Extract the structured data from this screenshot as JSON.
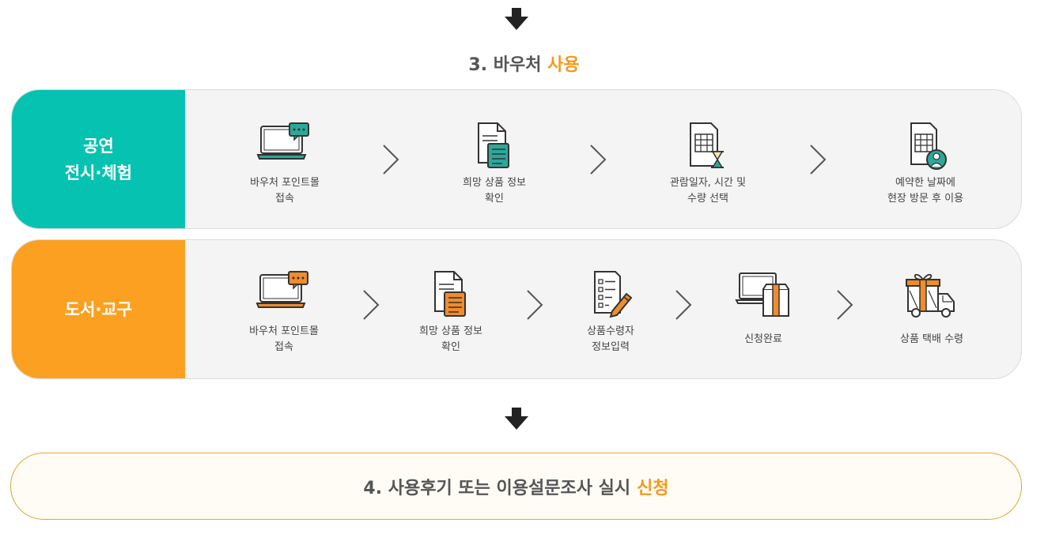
{
  "section3": {
    "title_main": "3. 바우처",
    "title_accent": "사용"
  },
  "performance": {
    "label_line1": "공연",
    "label_line2": "전시·체험",
    "steps": [
      {
        "line1": "바우처 포인트몰",
        "line2": "접속"
      },
      {
        "line1": "희망 상품 정보",
        "line2": "확인"
      },
      {
        "line1": "관람일자, 시간 및",
        "line2": "수량 선택"
      },
      {
        "line1": "예약한 날짜에",
        "line2": "현장 방문 후 이용"
      }
    ]
  },
  "books": {
    "label": "도서·교구",
    "steps": [
      {
        "line1": "바우처 포인트몰",
        "line2": "접속"
      },
      {
        "line1": "희망 상품 정보",
        "line2": "확인"
      },
      {
        "line1": "상품수령자",
        "line2": "정보입력"
      },
      {
        "line1": "신청완료",
        "line2": ""
      },
      {
        "line1": "상품 택배 수령",
        "line2": ""
      }
    ]
  },
  "section4": {
    "title_main": "4. 사용후기 또는 이용설문조사 실시",
    "title_accent": "신청"
  },
  "icons": {
    "laptop": "laptop-chat-icon",
    "document": "document-list-icon",
    "calendar": "calendar-hourglass-icon",
    "calendar_user": "calendar-user-icon",
    "form_pencil": "form-pencil-icon",
    "laptop_box": "laptop-box-icon",
    "gift_truck": "gift-truck-icon",
    "arrow": "arrow-down-icon",
    "chevron": "chevron-right-icon"
  },
  "colors": {
    "teal": "#06c2b1",
    "orange": "#fca021",
    "accent": "#f39a1e",
    "icon_teal": "#2aa99a",
    "icon_orange": "#f08c2b",
    "icon_dark": "#333333"
  }
}
